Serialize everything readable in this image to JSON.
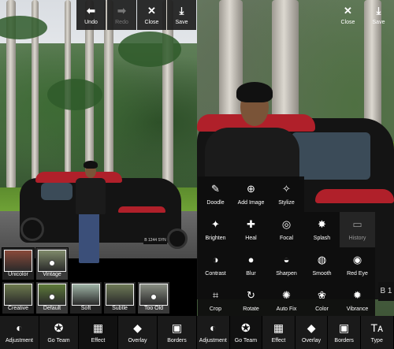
{
  "left_screen": {
    "top_bar": [
      {
        "name": "undo",
        "label": "Undo",
        "icon": "⬅",
        "enabled": true
      },
      {
        "name": "redo",
        "label": "Redo",
        "icon": "➡",
        "enabled": false
      },
      {
        "name": "close",
        "label": "Close",
        "icon": "✕",
        "enabled": true
      },
      {
        "name": "save",
        "label": "Save",
        "icon": "⤓",
        "enabled": true
      }
    ],
    "photo_plate": "B 1244 SYN",
    "effect_row_1": [
      {
        "label": "Unicolor",
        "selected": false,
        "tint": "#8a4a3a"
      },
      {
        "label": "Vintage",
        "selected": true,
        "tint": "#7f8a6a"
      }
    ],
    "effect_row_2": [
      {
        "label": "Creative",
        "selected": false,
        "tint": "#6d7a4e"
      },
      {
        "label": "Default",
        "selected": true,
        "tint": "#5e7b3a"
      },
      {
        "label": "Soft",
        "selected": false,
        "tint": "#9fb4a6"
      },
      {
        "label": "Subtle",
        "selected": false,
        "tint": "#6e7a57"
      },
      {
        "label": "Too Old",
        "selected": true,
        "tint": "#8a8f84"
      }
    ],
    "bottom_bar": [
      {
        "label": "Adjustment",
        "icon": "◐",
        "active": false
      },
      {
        "label": "Go Team",
        "icon": "✪",
        "active": false
      },
      {
        "label": "Effect",
        "icon": "▦",
        "active": true
      },
      {
        "label": "Overlay",
        "icon": "◆",
        "active": false
      },
      {
        "label": "Borders",
        "icon": "▣",
        "active": false
      }
    ]
  },
  "right_screen": {
    "top_bar": [
      {
        "name": "close",
        "label": "Close",
        "icon": "✕"
      },
      {
        "name": "save",
        "label": "Save",
        "icon": "⤓"
      }
    ],
    "tools": [
      {
        "label": "Doodle",
        "icon": "✎"
      },
      {
        "label": "Add Image",
        "icon": "⊕"
      },
      {
        "label": "Stylize",
        "icon": "✧"
      },
      {
        "label": "Brighten",
        "icon": "✦"
      },
      {
        "label": "Heal",
        "icon": "✚"
      },
      {
        "label": "Focal",
        "icon": "◎"
      },
      {
        "label": "Splash",
        "icon": "✸"
      },
      {
        "label": "History",
        "icon": "▭",
        "disabled": true
      },
      {
        "label": "Contrast",
        "icon": "◑"
      },
      {
        "label": "Blur",
        "icon": "●"
      },
      {
        "label": "Sharpen",
        "icon": "◒"
      },
      {
        "label": "Smooth",
        "icon": "◍"
      },
      {
        "label": "Red Eye",
        "icon": "◉"
      },
      {
        "label": "Crop",
        "icon": "⌗"
      },
      {
        "label": "Rotate",
        "icon": "↻"
      },
      {
        "label": "Auto Fix",
        "icon": "✺"
      },
      {
        "label": "Color",
        "icon": "❀"
      },
      {
        "label": "Vibrance",
        "icon": "✹"
      }
    ],
    "bottom_bar": [
      {
        "label": "Adjustment",
        "icon": "◐",
        "active": false
      },
      {
        "label": "Go Team",
        "icon": "✪",
        "active": true
      },
      {
        "label": "Effect",
        "icon": "▦",
        "active": false
      },
      {
        "label": "Overlay",
        "icon": "◆",
        "active": false
      },
      {
        "label": "Borders",
        "icon": "▣",
        "active": false
      },
      {
        "label": "Type",
        "icon": "Tᴀ",
        "active": false
      }
    ],
    "photo_plate_fragment": "B 1"
  }
}
